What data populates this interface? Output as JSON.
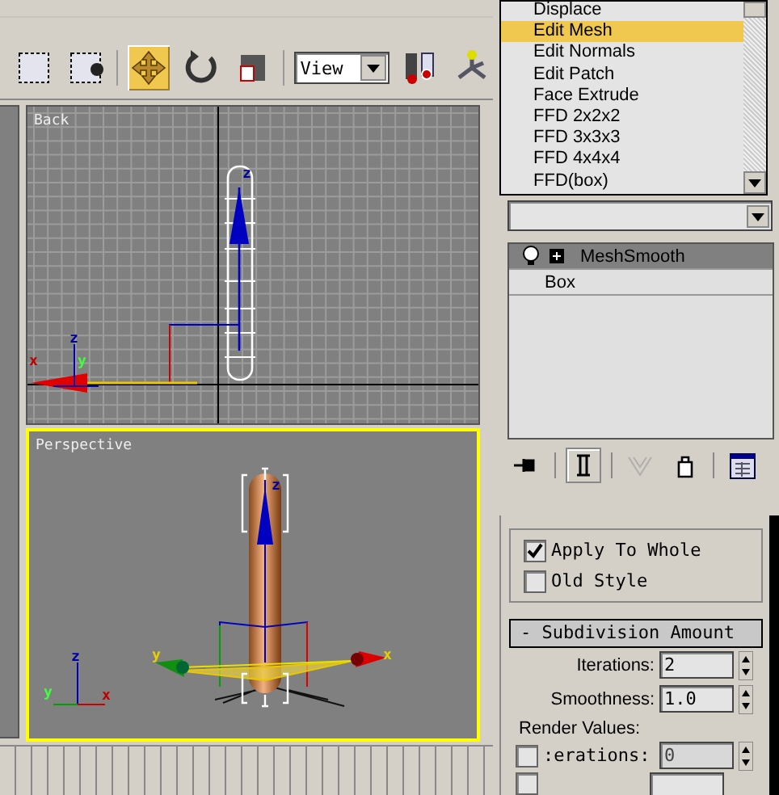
{
  "toolbar": {
    "tools": [
      {
        "kind": "select",
        "selected": false
      },
      {
        "kind": "select-circle",
        "selected": false
      },
      {
        "kind": "move",
        "selected": true
      },
      {
        "kind": "rotate",
        "selected": false
      },
      {
        "kind": "square",
        "selected": false
      },
      {
        "kind": "dropdown",
        "value": "View",
        "selected": false
      },
      {
        "kind": "pair",
        "selected": false
      },
      {
        "kind": "axis",
        "selected": false
      }
    ]
  },
  "viewports": [
    {
      "label": "Back",
      "active": false,
      "kind": "back",
      "gizmo_labels": [
        "z"
      ],
      "tripod_labels": [
        "z",
        "x",
        "y"
      ]
    },
    {
      "label": "Perspective",
      "active": true,
      "kind": "perspective",
      "gizmo_labels": [
        "z",
        "y",
        "x"
      ],
      "tripod_labels": [
        "z",
        "y",
        "x"
      ]
    }
  ],
  "modifier_list": {
    "items": [
      {
        "label": "Displace",
        "selected": false
      },
      {
        "label": "Edit Mesh",
        "selected": true
      },
      {
        "label": "Edit Normals",
        "selected": false
      },
      {
        "label": "Edit Patch",
        "selected": false
      },
      {
        "label": "Face Extrude",
        "selected": false
      },
      {
        "label": "FFD 2x2x2",
        "selected": false
      },
      {
        "label": "FFD 3x3x3",
        "selected": false
      },
      {
        "label": "FFD 4x4x4",
        "selected": false
      },
      {
        "label": "FFD(box)",
        "selected": false
      }
    ]
  },
  "modifier_stack": {
    "items": [
      {
        "label": "MeshSmooth",
        "kind": "modifier",
        "selected": true
      },
      {
        "label": "Box",
        "kind": "base",
        "selected": false
      }
    ]
  },
  "stack_tools": [
    {
      "kind": "pin",
      "selected": false,
      "disabled": false
    },
    {
      "kind": "end-result",
      "selected": true,
      "disabled": false
    },
    {
      "kind": "unique",
      "selected": false,
      "disabled": true
    },
    {
      "kind": "remove",
      "selected": false,
      "disabled": false
    },
    {
      "kind": "configure",
      "selected": false,
      "disabled": false
    }
  ],
  "parameters": {
    "checkboxes": [
      {
        "label": "Apply To Whole",
        "checked": true
      },
      {
        "label": "Old Style",
        "checked": false
      }
    ],
    "rollout_title": "- Subdivision Amount",
    "spinners": [
      {
        "label": "Iterations:",
        "value": "2"
      },
      {
        "label": "Smoothness:",
        "value": "1.0"
      }
    ],
    "render_values_label": "Render Values:",
    "render_spinners": [
      {
        "label": ":erations:",
        "value": "0",
        "checked": false,
        "disabled": true
      }
    ],
    "cut_row": {
      "checked": false
    }
  }
}
